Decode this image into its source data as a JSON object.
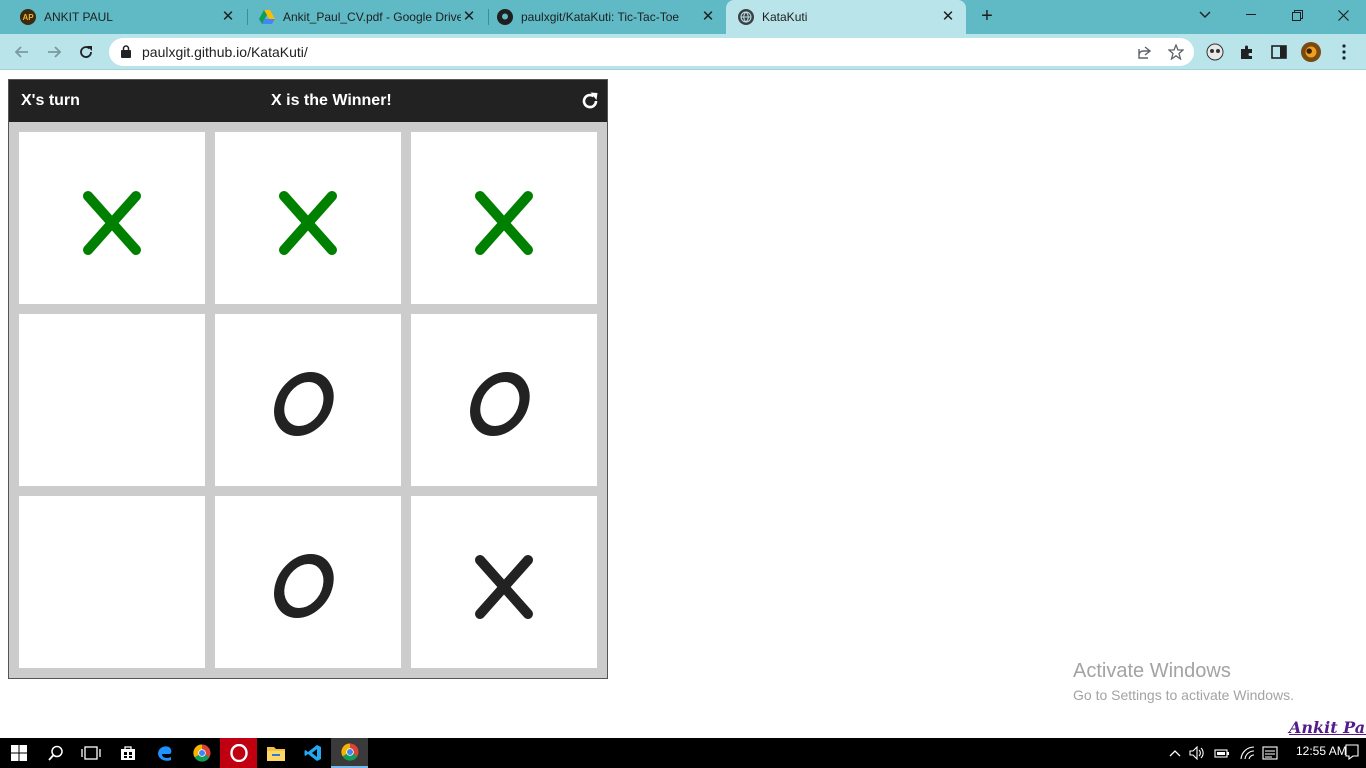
{
  "browser": {
    "tabs": [
      {
        "title": "ANKIT PAUL",
        "favicon": "ap-logo-icon",
        "active": false
      },
      {
        "title": "Ankit_Paul_CV.pdf - Google Drive",
        "favicon": "google-drive-icon",
        "active": false
      },
      {
        "title": "paulxgit/KataKuti: Tic-Tac-Toe",
        "favicon": "github-icon",
        "active": false
      },
      {
        "title": "KataKuti",
        "favicon": "globe-icon",
        "active": true
      }
    ],
    "url": "paulxgit.github.io/KataKuti/",
    "colors": {
      "tabstrip": "#5fbac5",
      "toolbar": "#b8e4ea"
    }
  },
  "game": {
    "turn_text": "X's turn",
    "status_text": "X is the Winner!",
    "reset_icon": "refresh-icon",
    "board": [
      [
        "X",
        "X",
        "X"
      ],
      [
        "",
        "O",
        "O"
      ],
      [
        "",
        "O",
        "X"
      ]
    ],
    "winning_line": [
      [
        0,
        0
      ],
      [
        0,
        1
      ],
      [
        0,
        2
      ]
    ],
    "colors": {
      "header": "#222222",
      "mark": "#222222",
      "winning_mark": "#008000",
      "grid": "#cccccc"
    }
  },
  "watermark": {
    "title": "Activate Windows",
    "subtitle": "Go to Settings to activate Windows."
  },
  "credit": "Ankit Paul",
  "taskbar": {
    "apps": [
      "windows-start-icon",
      "search-icon",
      "task-view-icon",
      "store-icon",
      "edge-icon",
      "chrome-icon",
      "opera-icon",
      "file-explorer-icon",
      "vscode-icon",
      "chrome-icon"
    ],
    "time": "12:55 AM"
  }
}
